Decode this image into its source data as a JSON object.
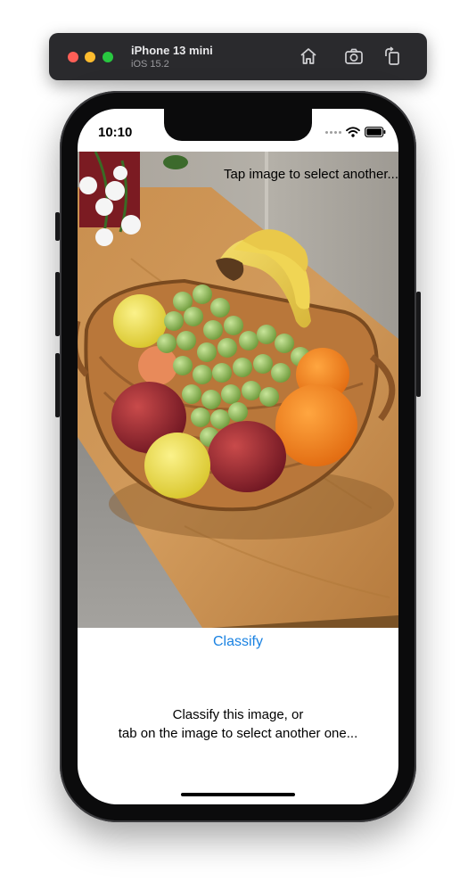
{
  "simulator": {
    "device_name": "iPhone 13 mini",
    "os_version": "iOS 15.2",
    "buttons": [
      {
        "name": "home",
        "icon": "home-icon"
      },
      {
        "name": "screenshot",
        "icon": "camera-icon"
      },
      {
        "name": "rotate",
        "icon": "rotate-icon"
      }
    ]
  },
  "status_bar": {
    "time": "10:10",
    "icons": [
      "signal-dots-icon",
      "wifi-icon",
      "battery-icon"
    ]
  },
  "app": {
    "image_hint": "Tap image to select another...",
    "image_description_icon": "fruit-basket-photo",
    "classify_label": "Classify",
    "instruction_line1": "Classify this image, or",
    "instruction_line2": "tab on the image to select another one..."
  },
  "colors": {
    "accent": "#1a82e2",
    "traffic_red": "#fe5f57",
    "traffic_yellow": "#febc2e",
    "traffic_green": "#28c840"
  }
}
